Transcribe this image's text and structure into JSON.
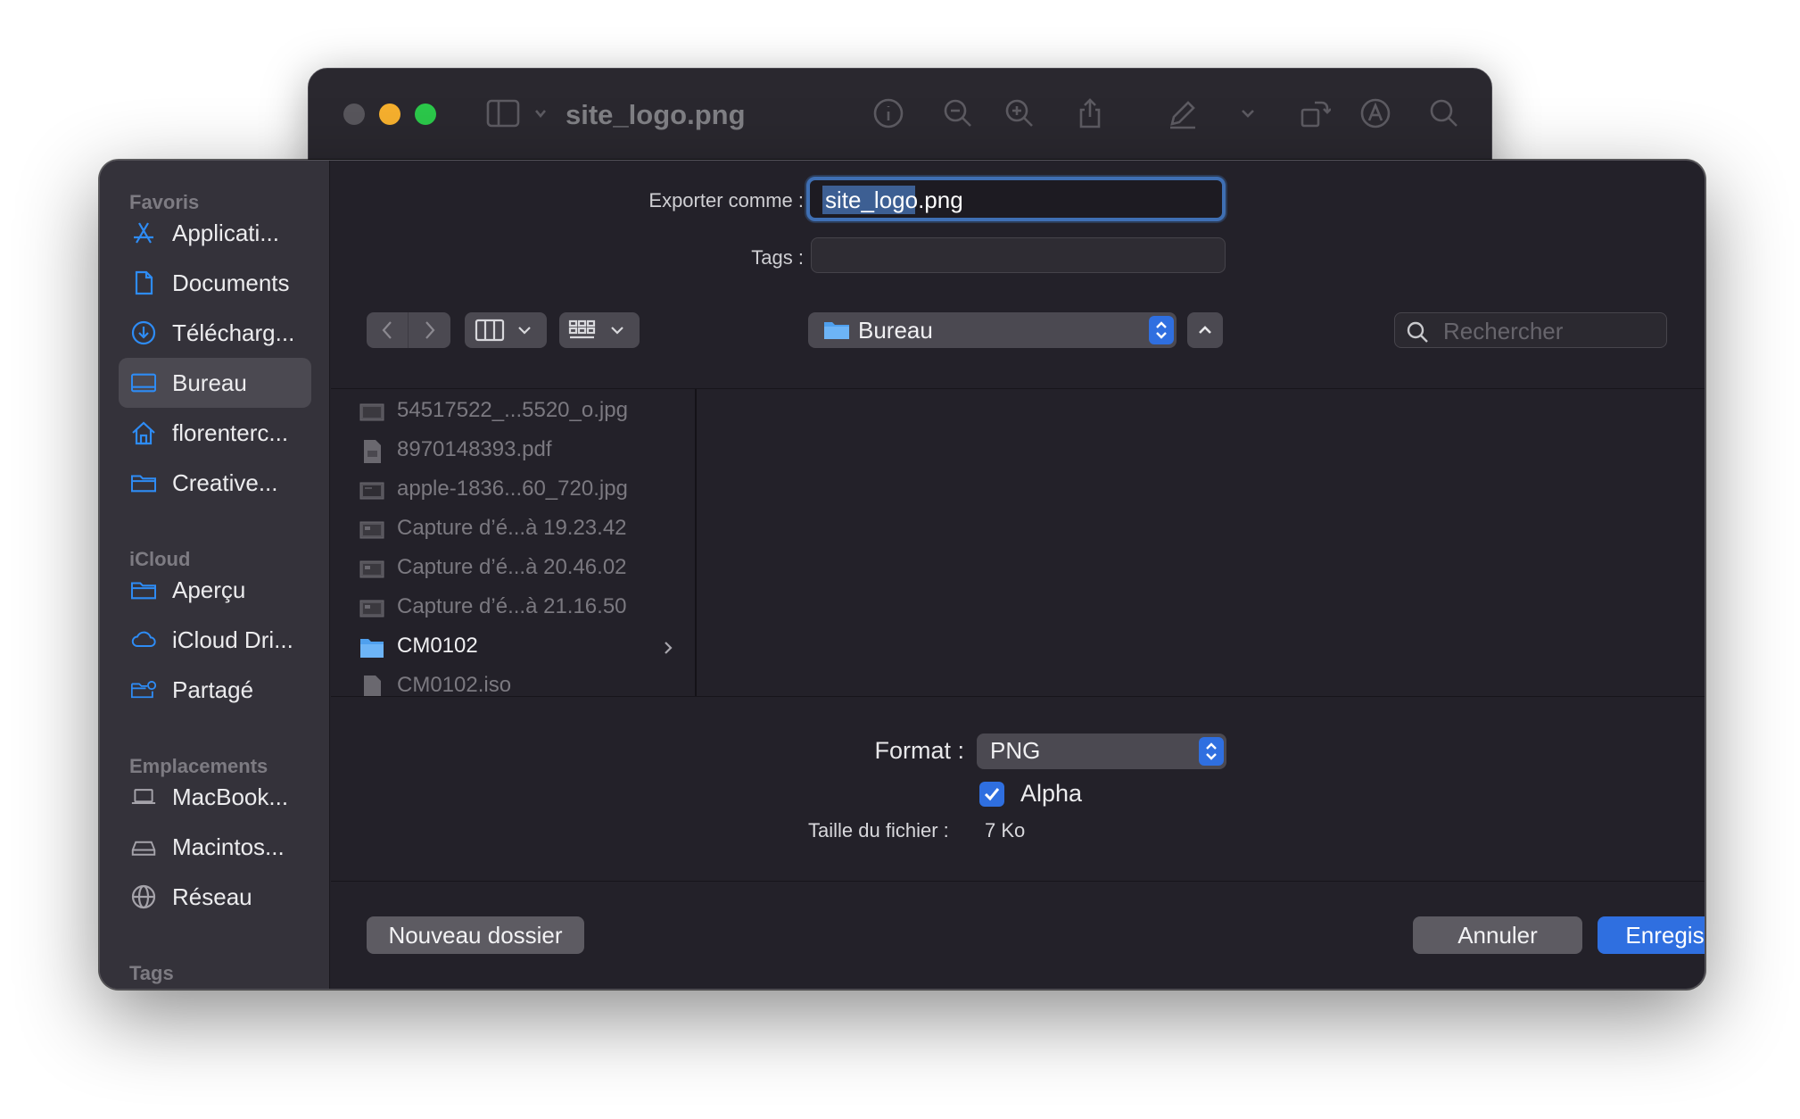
{
  "background_window": {
    "title": "site_logo.png",
    "toolbar_icons": [
      "sidebar-toggle-icon",
      "chevron-down-icon",
      "info-icon",
      "zoom-out-icon",
      "zoom-in-icon",
      "share-icon",
      "markup-pen-icon",
      "chevron-down-icon",
      "rotate-icon",
      "annotate-icon",
      "search-icon"
    ]
  },
  "sidebar": {
    "sections": [
      {
        "title": "Favoris",
        "items": [
          {
            "label": "Applicati...",
            "icon": "applications-icon"
          },
          {
            "label": "Documents",
            "icon": "document-icon"
          },
          {
            "label": "Télécharg...",
            "icon": "downloads-icon"
          },
          {
            "label": "Bureau",
            "icon": "desktop-icon",
            "selected": true
          },
          {
            "label": "florenterc...",
            "icon": "home-icon"
          },
          {
            "label": "Creative...",
            "icon": "folder-icon"
          }
        ]
      },
      {
        "title": "iCloud",
        "items": [
          {
            "label": "Aperçu",
            "icon": "folder-icon"
          },
          {
            "label": "iCloud Dri...",
            "icon": "cloud-icon"
          },
          {
            "label": "Partagé",
            "icon": "shared-folder-icon"
          }
        ]
      },
      {
        "title": "Emplacements",
        "items": [
          {
            "label": "MacBook...",
            "icon": "laptop-icon"
          },
          {
            "label": "Macintos...",
            "icon": "disk-icon"
          },
          {
            "label": "Réseau",
            "icon": "network-icon"
          }
        ]
      },
      {
        "title": "Tags",
        "items": []
      }
    ]
  },
  "export": {
    "label": "Exporter comme :",
    "filename_selected": "site_logo",
    "filename_ext": ".png",
    "tags_label": "Tags :",
    "tags_value": ""
  },
  "toolbar": {
    "location": "Bureau",
    "search_placeholder": "Rechercher"
  },
  "files": [
    {
      "name": "54517522_...5520_o.jpg",
      "type": "image"
    },
    {
      "name": "8970148393.pdf",
      "type": "pdf"
    },
    {
      "name": "apple-1836...60_720.jpg",
      "type": "image"
    },
    {
      "name": "Capture d’é...à 19.23.42",
      "type": "image"
    },
    {
      "name": "Capture d’é...à 20.46.02",
      "type": "image"
    },
    {
      "name": "Capture d’é...à 21.16.50",
      "type": "image"
    },
    {
      "name": "CM0102",
      "type": "folder"
    },
    {
      "name": "CM0102.iso",
      "type": "file"
    }
  ],
  "options": {
    "format_label": "Format :",
    "format_value": "PNG",
    "alpha_label": "Alpha",
    "alpha_checked": true,
    "filesize_label": "Taille du fichier :",
    "filesize_value": "7 Ko"
  },
  "buttons": {
    "new_folder": "Nouveau dossier",
    "cancel": "Annuler",
    "save": "Enregistrer"
  },
  "colors": {
    "accent": "#2f6fe0",
    "sidebar_icon": "#2e8cf5",
    "dialog_bg": "#232129",
    "sidebar_bg": "#34323a"
  }
}
